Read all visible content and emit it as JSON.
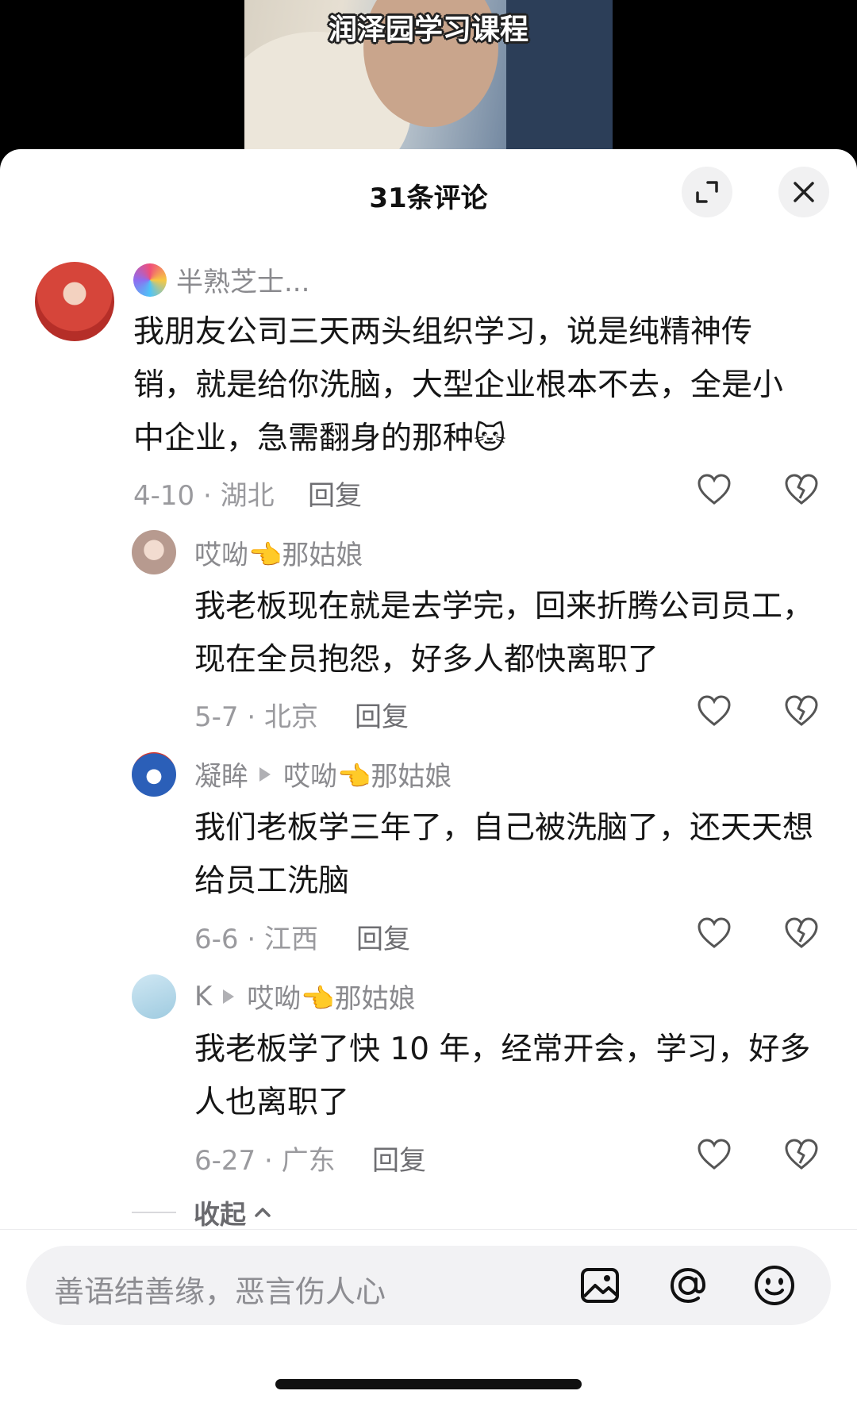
{
  "video": {
    "caption": "润泽园学习课程"
  },
  "header": {
    "title": "31条评论"
  },
  "comments": [
    {
      "username": "半熟芝士...",
      "text": "我朋友公司三天两头组织学习，说是纯精神传销，就是给你洗脑，大型企业根本不去，全是小中企业，急需翻身的那种🐱",
      "meta": "4-10 · 湖北",
      "reply_label": "回复"
    }
  ],
  "replies": [
    {
      "username": "哎呦👈那姑娘",
      "reply_to": "",
      "text": "我老板现在就是去学完，回来折腾公司员工，现在全员抱怨，好多人都快离职了",
      "meta": "5-7 · 北京",
      "reply_label": "回复"
    },
    {
      "username": "凝眸",
      "reply_to": "哎呦👈那姑娘",
      "text": "我们老板学三年了，自己被洗脑了，还天天想给员工洗脑",
      "meta": "6-6 · 江西",
      "reply_label": "回复"
    },
    {
      "username": "K",
      "reply_to": "哎呦👈那姑娘",
      "text": "我老板学了快 10 年，经常开会，学习，好多人也离职了",
      "meta": "6-27 · 广东",
      "reply_label": "回复"
    }
  ],
  "collapse_label": "收起",
  "input": {
    "placeholder": "善语结善缘，恶言伤人心"
  },
  "icons": {
    "expand": "expand-icon",
    "close": "close-icon",
    "like": "heart-icon",
    "dislike": "broken-heart-icon",
    "image": "image-icon",
    "mention": "at-icon",
    "emoji": "emoji-icon"
  }
}
